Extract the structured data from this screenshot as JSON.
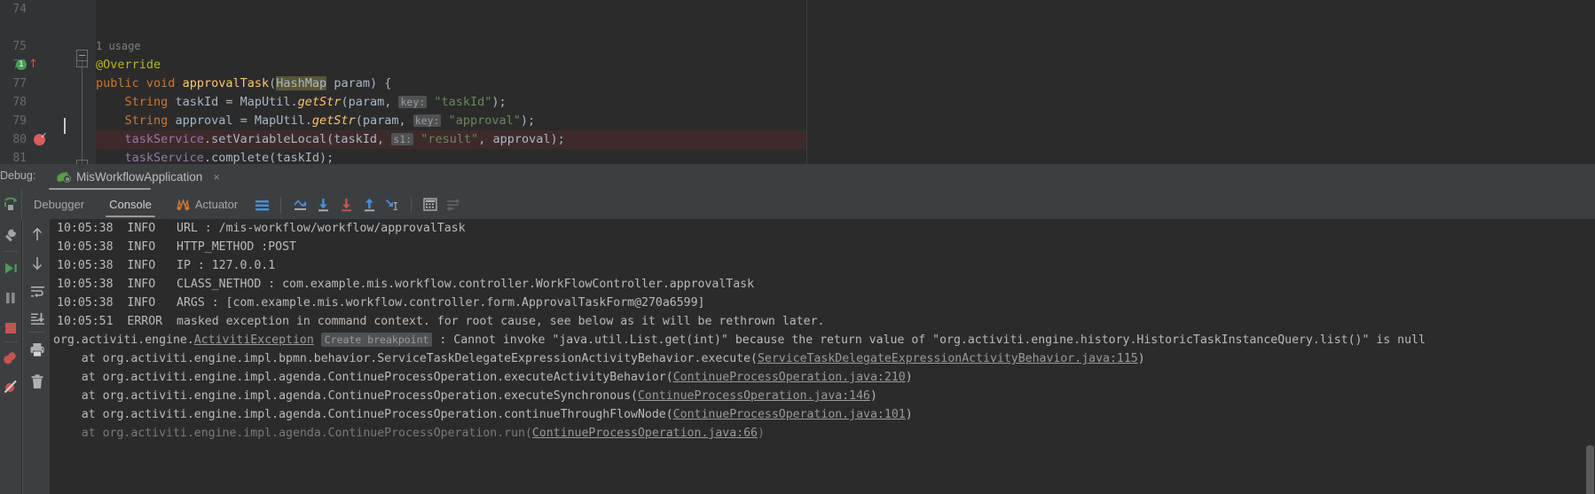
{
  "editor": {
    "lines": [
      {
        "num": "74",
        "text": ""
      },
      {
        "num": "",
        "text": "1 usage",
        "kind": "usage"
      },
      {
        "num": "75",
        "text": "@Override"
      },
      {
        "num": "76",
        "text": "public void approvalTask(HashMap param) {"
      },
      {
        "num": "77",
        "text": "String taskId = MapUtil.getStr(param,  key: \"taskId\");"
      },
      {
        "num": "78",
        "text": "String approval = MapUtil.getStr(param,  key: \"approval\");"
      },
      {
        "num": "79",
        "text": "taskService.setVariableLocal(taskId,  s1: \"result\", approval);"
      },
      {
        "num": "80",
        "text": "taskService.complete(taskId);"
      },
      {
        "num": "81",
        "text": "}"
      }
    ],
    "line_numbers": [
      "74",
      "75",
      "76",
      "77",
      "78",
      "79",
      "80",
      "81"
    ],
    "usage_label": "1 usage",
    "tokens": {
      "override": "@Override",
      "kw_public": "public",
      "kw_void": "void",
      "method_name": "approvalTask",
      "param_type": "HashMap",
      "param_name": "param",
      "type_string": "String",
      "var_taskid": "taskId",
      "var_approval": "approval",
      "maputil": "MapUtil",
      "getstr": "getStr",
      "hint_key": "key:",
      "hint_s1": "s1:",
      "str_taskid": "\"taskId\"",
      "str_approval": "\"approval\"",
      "str_result": "\"result\"",
      "taskservice": "taskService",
      "setvariablelocal": "setVariableLocal",
      "complete": "complete",
      "run_marker": "1"
    }
  },
  "debug_header": {
    "label": "Debug:",
    "tab_title": "MisWorkflowApplication",
    "close_label": "×",
    "icon": "spring-boot-icon"
  },
  "console_tabs": [
    {
      "label": "Debugger",
      "active": false,
      "icon": null
    },
    {
      "label": "Console",
      "active": true,
      "icon": null
    },
    {
      "label": "Actuator",
      "active": false,
      "icon": "actuator-icon"
    }
  ],
  "toolbar_buttons": [
    {
      "name": "soft-wrap-button",
      "icon": "soft-wrap-icon",
      "color": "#4a90d9"
    },
    {
      "name": "scroll-to-top-button",
      "icon": "scroll-up-end-icon",
      "color": "#4a90d9"
    },
    {
      "name": "scroll-to-bottom-button",
      "icon": "arrow-down-to-line-icon",
      "color": "#4a90d9"
    },
    {
      "name": "scroll-to-end-red-button",
      "icon": "arrow-down-red-icon",
      "color": "#c75450"
    },
    {
      "name": "scroll-to-start-button",
      "icon": "arrow-up-from-line-icon",
      "color": "#4a90d9"
    },
    {
      "name": "scroll-to-cursor-button",
      "icon": "arrow-to-cursor-icon",
      "color": "#4a90d9"
    },
    {
      "name": "print-table-button",
      "icon": "table-icon",
      "color": "#a9a9a9"
    },
    {
      "name": "settings-list-button",
      "icon": "list-settings-icon",
      "color": "#5d6164"
    }
  ],
  "side_toolbar_left": [
    {
      "name": "rerun-button",
      "icon": "rerun-green-icon",
      "color": "#499c54"
    },
    {
      "name": "debug-settings-button",
      "icon": "wrench-icon",
      "color": "#a5a5a5"
    },
    {
      "name": "resume-program-button",
      "icon": "play-green-icon",
      "color": "#499c54"
    },
    {
      "name": "pause-program-button",
      "icon": "pause-icon",
      "color": "#8a8a8a"
    },
    {
      "name": "stop-button",
      "icon": "stop-red-icon",
      "color": "#c75450"
    },
    {
      "name": "view-breakpoints-button",
      "icon": "breakpoints-icon",
      "color": "#c75450"
    },
    {
      "name": "mute-breakpoints-button",
      "icon": "mute-breakpoints-icon",
      "color": "#c75450"
    }
  ],
  "side_toolbar_right": [
    {
      "name": "scroll-up-button",
      "icon": "arrow-up-icon",
      "color": "#b0b0b0"
    },
    {
      "name": "scroll-down-button",
      "icon": "arrow-down-icon",
      "color": "#b0b0b0"
    },
    {
      "name": "soft-wrap-lines-button",
      "icon": "wrap-lines-icon",
      "color": "#b0b0b0"
    },
    {
      "name": "scroll-to-end-button",
      "icon": "scroll-end-icon",
      "color": "#b0b0b0"
    },
    {
      "name": "print-button",
      "icon": "printer-icon",
      "color": "#b0b0b0"
    },
    {
      "name": "clear-all-button",
      "icon": "trash-icon",
      "color": "#b0b0b0"
    }
  ],
  "console_log": [
    {
      "type": "info",
      "time": "10:05:38",
      "level": "INFO",
      "message": "URL : /mis-workflow/workflow/approvalTask"
    },
    {
      "type": "info",
      "time": "10:05:38",
      "level": "INFO",
      "message": "HTTP_METHOD :POST"
    },
    {
      "type": "info",
      "time": "10:05:38",
      "level": "INFO",
      "message": "IP : 127.0.0.1"
    },
    {
      "type": "info",
      "time": "10:05:38",
      "level": "INFO",
      "message": "CLASS_NETHOD : com.example.mis.workflow.controller.WorkFlowController.approvalTask"
    },
    {
      "type": "info",
      "time": "10:05:38",
      "level": "INFO",
      "message": "ARGS : [com.example.mis.workflow.controller.form.ApprovalTaskForm@270a6599]"
    },
    {
      "type": "error",
      "time": "10:05:51",
      "level": "ERROR",
      "message": "masked exception in command context. for root cause, see below as it will be rethrown later."
    }
  ],
  "exception": {
    "prefix": "org.activiti.engine.",
    "class_link": "ActivitiException",
    "create_breakpoint": "Create breakpoint",
    "separator": " : ",
    "message": "Cannot invoke \"java.util.List.get(int)\" because the return value of \"org.activiti.engine.history.HistoricTaskInstanceQuery.list()\" is null"
  },
  "stack_trace": [
    {
      "prefix": "    at org.activiti.engine.impl.bpmn.behavior.ServiceTaskDelegateExpressionActivityBehavior.execute(",
      "link": "ServiceTaskDelegateExpressionActivityBehavior.java:115",
      "suffix": ")"
    },
    {
      "prefix": "    at org.activiti.engine.impl.agenda.ContinueProcessOperation.executeActivityBehavior(",
      "link": "ContinueProcessOperation.java:210",
      "suffix": ")"
    },
    {
      "prefix": "    at org.activiti.engine.impl.agenda.ContinueProcessOperation.executeSynchronous(",
      "link": "ContinueProcessOperation.java:146",
      "suffix": ")"
    },
    {
      "prefix": "    at org.activiti.engine.impl.agenda.ContinueProcessOperation.continueThroughFlowNode(",
      "link": "ContinueProcessOperation.java:101",
      "suffix": ")"
    },
    {
      "prefix": "    at org.activiti.engine.impl.agenda.ContinueProcessOperation.run(",
      "link": "ContinueProcessOperation.java:66",
      "suffix": ")"
    }
  ],
  "colors": {
    "editor_bg": "#2b2b2b",
    "panel_bg": "#3c3f41",
    "breakpoint_row": "#3d2b2b",
    "accent_blue": "#4a90d9",
    "error_red": "#c75450",
    "green": "#499c54"
  }
}
